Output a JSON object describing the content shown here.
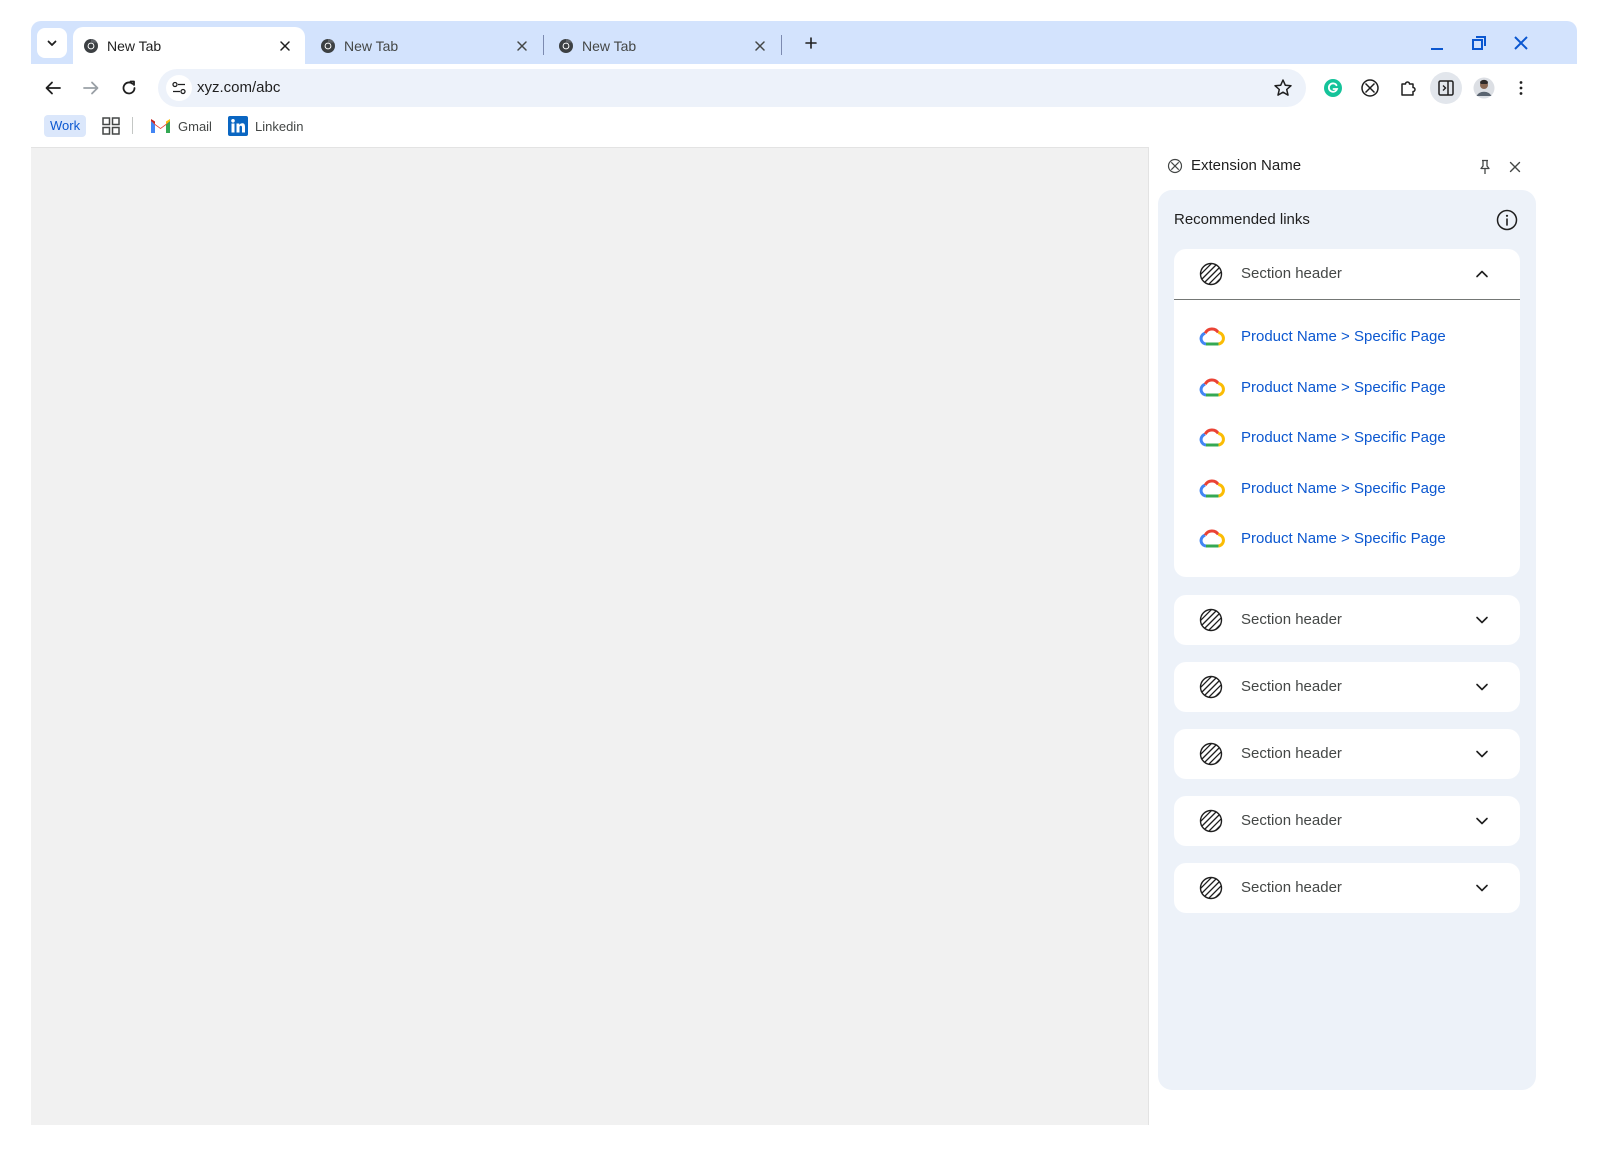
{
  "tabs": [
    {
      "title": "New Tab",
      "active": true
    },
    {
      "title": "New Tab",
      "active": false
    },
    {
      "title": "New Tab",
      "active": false
    }
  ],
  "omnibox": {
    "url": "xyz.com/abc"
  },
  "bookmarks": {
    "work_label": "Work",
    "items": [
      {
        "label": "Gmail",
        "icon": "gmail-icon"
      },
      {
        "label": "Linkedin",
        "icon": "linkedin-icon"
      }
    ]
  },
  "side_panel": {
    "title": "Extension Name",
    "card_title": "Recommended links",
    "expanded_section": {
      "header": "Section header",
      "links": [
        {
          "label": "Product Name > Specific Page",
          "icon": "google-cloud-icon"
        },
        {
          "label": "Product Name > Specific Page",
          "icon": "google-cloud-icon"
        },
        {
          "label": "Product Name > Specific Page",
          "icon": "google-cloud-icon"
        },
        {
          "label": "Product Name > Specific Page",
          "icon": "google-cloud-icon"
        },
        {
          "label": "Product Name > Specific Page",
          "icon": "google-cloud-icon"
        }
      ]
    },
    "collapsed_sections": [
      {
        "header": "Section header"
      },
      {
        "header": "Section header"
      },
      {
        "header": "Section header"
      },
      {
        "header": "Section header"
      },
      {
        "header": "Section header"
      }
    ]
  },
  "colors": {
    "tabstrip": "#d3e3fd",
    "omnibox": "#edf2fa",
    "link": "#0b57d0",
    "panel_card": "#edf2f9",
    "content_bg": "#f1f1f1"
  }
}
